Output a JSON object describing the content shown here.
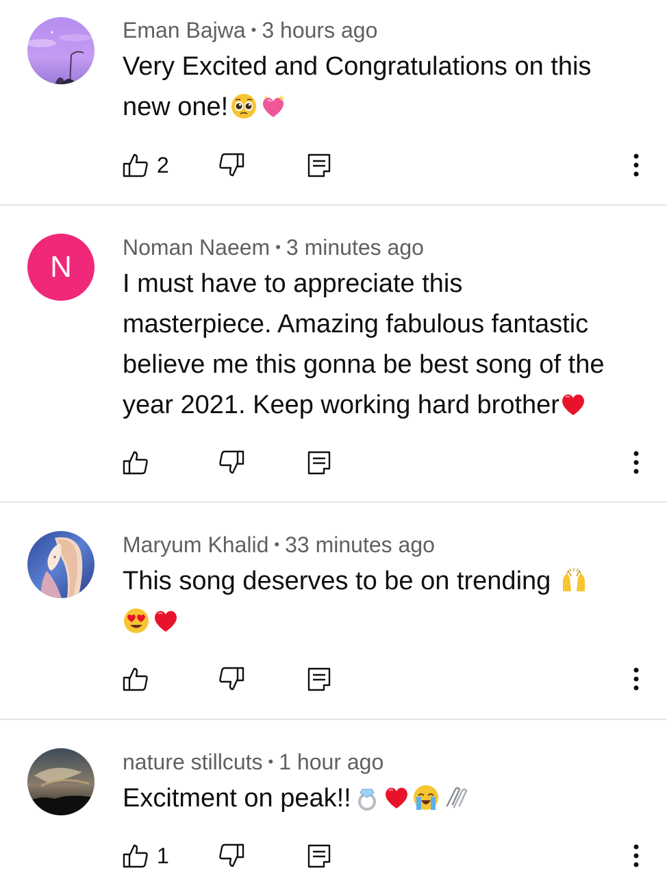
{
  "comments": [
    {
      "author": "Eman Bajwa",
      "time": "3 hours ago",
      "text_lines": [
        "Very Excited and Congratulations on this",
        "new one!"
      ],
      "emojis": [
        "pleading-face",
        "sparkling-heart"
      ],
      "likes": "2",
      "avatar": "purple-sky-photo"
    },
    {
      "author": "Noman Naeem",
      "time": "3 minutes ago",
      "text_lines": [
        "I must have to appreciate this",
        "masterpiece. Amazing fabulous fantastic",
        "believe me this gonna be best song of the",
        "year 2021. Keep working hard brother"
      ],
      "emojis": [
        "red-heart"
      ],
      "likes": "",
      "avatar_letter": "N",
      "avatar_color": "#f0287a"
    },
    {
      "author": "Maryum Khalid",
      "time": "33 minutes ago",
      "text_lines": [
        "This song deserves to be on trending",
        ""
      ],
      "emojis": [
        "raising-hands",
        "heart-eyes",
        "red-heart"
      ],
      "likes": "",
      "avatar": "illustrated-girl"
    },
    {
      "author": "nature stillcuts",
      "time": "1 hour ago",
      "text_lines": [
        "Excitment on peak!!"
      ],
      "emojis": [
        "ring",
        "red-heart",
        "loudly-crying-face",
        "paperclips"
      ],
      "likes": "1",
      "avatar": "cloud-sky-photo"
    }
  ],
  "separator": "•"
}
